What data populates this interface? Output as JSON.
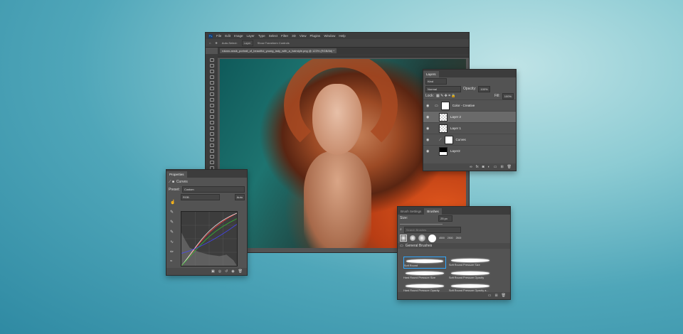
{
  "photoshop": {
    "menu": [
      "File",
      "Edit",
      "Image",
      "Layer",
      "Type",
      "Select",
      "Filter",
      "3D",
      "View",
      "Plugins",
      "Window",
      "Help"
    ],
    "options": {
      "auto_select": "Auto-Select:",
      "layer_dropdown": "Layer",
      "transform": "Show Transform Controls"
    },
    "doc_tab": "rokaro.ansik_portrait_of_beautiful_young_lady_with_a_hairstyle.png @ 123% (RGB/8#) *"
  },
  "layers": {
    "title": "Layers",
    "kind": "Kind",
    "blend": "Normal",
    "opacity_label": "Opacity:",
    "opacity": "100%",
    "lock_label": "Lock:",
    "fill_label": "Fill:",
    "fill": "100%",
    "items": [
      {
        "name": "Color - Creative"
      },
      {
        "name": "Layer 2"
      },
      {
        "name": "Layer 1"
      },
      {
        "name": "Curves"
      },
      {
        "name": "Layer2"
      }
    ]
  },
  "properties": {
    "title": "Properties",
    "adjustment": "Curves",
    "preset_label": "Preset:",
    "preset": "Custom",
    "channel": "RGB",
    "auto": "Auto"
  },
  "brushes": {
    "tabs": [
      "Brush Settings",
      "Brushes"
    ],
    "size_label": "Size:",
    "size": "25 px",
    "search_placeholder": "Search Brushes",
    "presets": [
      "4500",
      "2500",
      "2500"
    ],
    "group": "General Brushes",
    "items": [
      "Soft Round",
      "Soft Round Pressure Size",
      "Hard Round Pressure Size",
      "Soft Round Pressure Opacity",
      "Hard Round Pressure Opacity",
      "Soft Round Pressure Opacity a..."
    ]
  }
}
